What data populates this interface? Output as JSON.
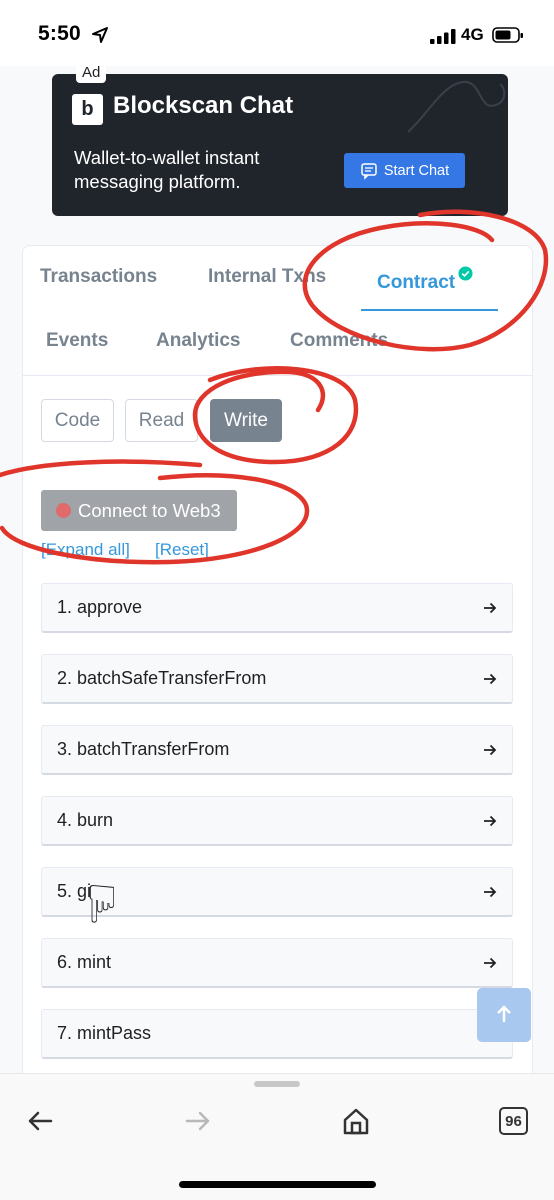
{
  "status_bar": {
    "time": "5:50",
    "carrier": "4G"
  },
  "ad": {
    "label": "Ad",
    "logo_letter": "b",
    "title": "Blockscan Chat",
    "text": "Wallet-to-wallet instant messaging platform.",
    "button": "Start Chat"
  },
  "tabs": [
    {
      "label": "Transactions",
      "active": false
    },
    {
      "label": "Internal Txns",
      "active": false
    },
    {
      "label": "Contract",
      "active": true,
      "verified": true
    },
    {
      "label": "Events",
      "active": false
    },
    {
      "label": "Analytics",
      "active": false
    },
    {
      "label": "Comments",
      "active": false
    }
  ],
  "sub_tabs": [
    {
      "label": "Code",
      "active": false
    },
    {
      "label": "Read",
      "active": false
    },
    {
      "label": "Write",
      "active": true
    }
  ],
  "connect_button": "Connect to Web3",
  "expand_all": "[Expand all]",
  "reset": "[Reset]",
  "functions": [
    "1. approve",
    "2. batchSafeTransferFrom",
    "3. batchTransferFrom",
    "4. burn",
    "5. gi",
    "6. mint",
    "7. mintPass"
  ],
  "toolbar": {
    "tab_count": "96"
  },
  "colors": {
    "accent": "#3498db",
    "annotation": "#e0352b",
    "ad_bg": "#20252c"
  }
}
